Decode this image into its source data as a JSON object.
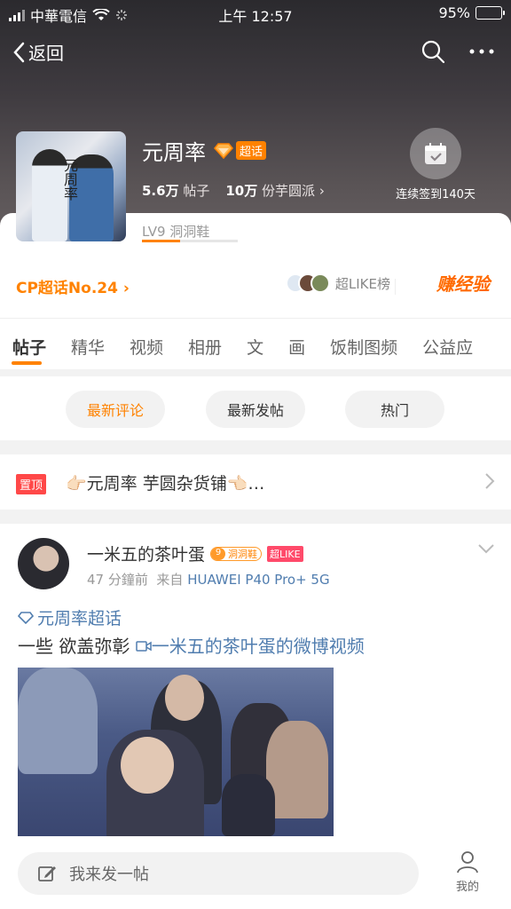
{
  "status_bar": {
    "carrier": "中華電信",
    "time": "上午 12:57",
    "battery": "95%"
  },
  "nav": {
    "back_label": "返回"
  },
  "topic": {
    "name": "元周率",
    "super_label": "超话",
    "posts_count": "5.6万",
    "posts_label": "帖子",
    "fans_count": "10万",
    "fans_label": "份芋圆派",
    "checkin_text": "连续签到140天",
    "level_text": "LV9 洞洞鞋",
    "level_progress": 0.4
  },
  "rank": {
    "cp_text": "CP超话No.24",
    "like_list": "超LIKE榜",
    "earn": "赚经验"
  },
  "tabs": [
    "帖子",
    "精华",
    "视频",
    "相册",
    "文",
    "画",
    "饭制图频",
    "公益应"
  ],
  "sort": {
    "latest_comment": "最新评论",
    "latest_post": "最新发帖",
    "hot": "热门"
  },
  "pinned": {
    "tag": "置顶",
    "text": "👉🏻元周率 芋圆杂货铺👈🏻…"
  },
  "post": {
    "username": "一米五的茶叶蛋",
    "level_num": "9",
    "level_name": "洞洞鞋",
    "like_badge": "超LIKE",
    "time": "47 分鐘前",
    "from_label": "来自",
    "device": "HUAWEI P40 Pro+ 5G",
    "topic_tag": "元周率超话",
    "text": "一些 欲盖弥彰 ",
    "video_link": "一米五的茶叶蛋的微博视频"
  },
  "bottom": {
    "compose_placeholder": "我来发一帖",
    "me_label": "我的"
  },
  "colors": {
    "accent": "#ff8200",
    "link": "#507daf",
    "pin": "#ff4848"
  }
}
